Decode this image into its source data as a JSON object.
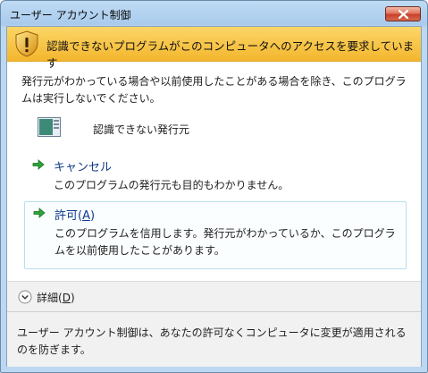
{
  "window": {
    "title": "ユーザー アカウント制御"
  },
  "banner": {
    "text": "認識できないプログラムがこのコンピュータへのアクセスを要求しています"
  },
  "description": "発行元がわかっている場合や以前使用したことがある場合を除き、このプログラムは実行しないでください。",
  "program": {
    "publisher": "認識できない発行元"
  },
  "options": {
    "cancel": {
      "title": "キャンセル",
      "desc": "このプログラムの発行元も目的もわかりません。"
    },
    "allow": {
      "title_prefix": "許可(",
      "title_key": "A",
      "title_suffix": ")",
      "desc": "このプログラムを信用します。発行元がわかっているか、このプログラムを以前使用したことがあります。"
    }
  },
  "details": {
    "label_prefix": "詳細(",
    "label_key": "D",
    "label_suffix": ")"
  },
  "footer": {
    "text": "ユーザー アカウント制御は、あなたの許可なくコンピュータに変更が適用されるのを防ぎます。"
  },
  "icons": {
    "banner": "shield-warning-icon",
    "program": "program-window-icon",
    "option": "green-arrow-icon",
    "close": "close-icon",
    "details": "chevron-down-icon"
  },
  "colors": {
    "banner": "#f7c242",
    "link": "#0f3b8a",
    "close": "#c8412a",
    "arrow": "#2ea43a"
  }
}
